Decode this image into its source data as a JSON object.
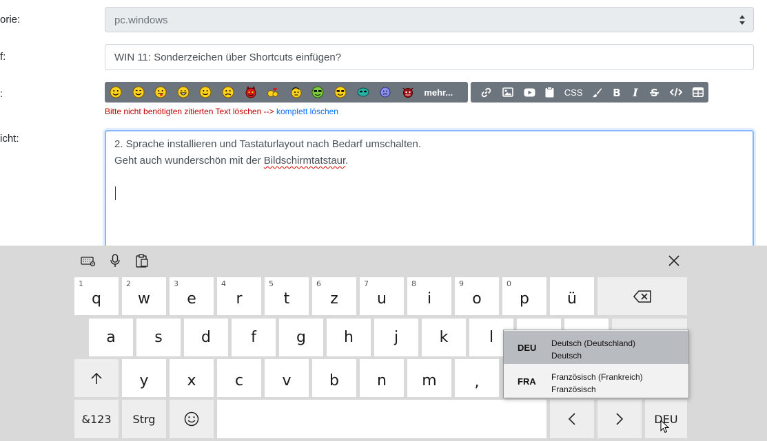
{
  "form": {
    "category_label": "orie:",
    "category_value": "pc.windows",
    "subject_label": "f:",
    "subject_value": "WIN 11: Sonderzeichen über Shortcuts einfügen?",
    "toolbar_label": ":",
    "message_label": "icht:",
    "more_smilies": "mehr...",
    "css_label": "CSS",
    "warning_text": "Bitte nicht benötigten zitierten Text löschen -->",
    "delete_link": "komplett löschen",
    "message_line1": "2. Sprache installieren und Tastaturlayout nach Bedarf umschalten.",
    "message_line2_pre": "Geht auch wunderschön mit der ",
    "message_line2_misspelled": "Bildschirmtatstaur",
    "message_line2_post": "."
  },
  "colors": {
    "toolbar_bg": "#6c757d",
    "warning_red": "#c00000",
    "link_blue": "#0d6efd",
    "focus_border": "#86b7fe",
    "keyboard_bg": "#d9d9d9"
  },
  "keyboard": {
    "row1": [
      {
        "num": "1",
        "ch": "q"
      },
      {
        "num": "2",
        "ch": "w"
      },
      {
        "num": "3",
        "ch": "e"
      },
      {
        "num": "4",
        "ch": "r"
      },
      {
        "num": "5",
        "ch": "t"
      },
      {
        "num": "6",
        "ch": "z"
      },
      {
        "num": "7",
        "ch": "u"
      },
      {
        "num": "8",
        "ch": "i"
      },
      {
        "num": "9",
        "ch": "o"
      },
      {
        "num": "0",
        "ch": "p"
      },
      {
        "num": "",
        "ch": "ü"
      }
    ],
    "row2": [
      "a",
      "s",
      "d",
      "f",
      "g",
      "h",
      "j",
      "k",
      "l"
    ],
    "row3": [
      "y",
      "x",
      "c",
      "v",
      "b",
      "n",
      "m",
      ","
    ],
    "numbers_key": "&123",
    "ctrl_key": "Strg",
    "language_key": "DEU",
    "icons": [
      "keyboard-settings-icon",
      "microphone-icon",
      "clipboard-icon",
      "close-icon",
      "backspace-icon",
      "shift-icon",
      "emoji-icon",
      "arrow-left-icon",
      "arrow-right-icon"
    ]
  },
  "language_popup": [
    {
      "code": "DEU",
      "name": "Deutsch (Deutschland)",
      "sub": "Deutsch",
      "selected": true
    },
    {
      "code": "FRA",
      "name": "Französisch (Frankreich)",
      "sub": "Französisch",
      "selected": false
    }
  ]
}
